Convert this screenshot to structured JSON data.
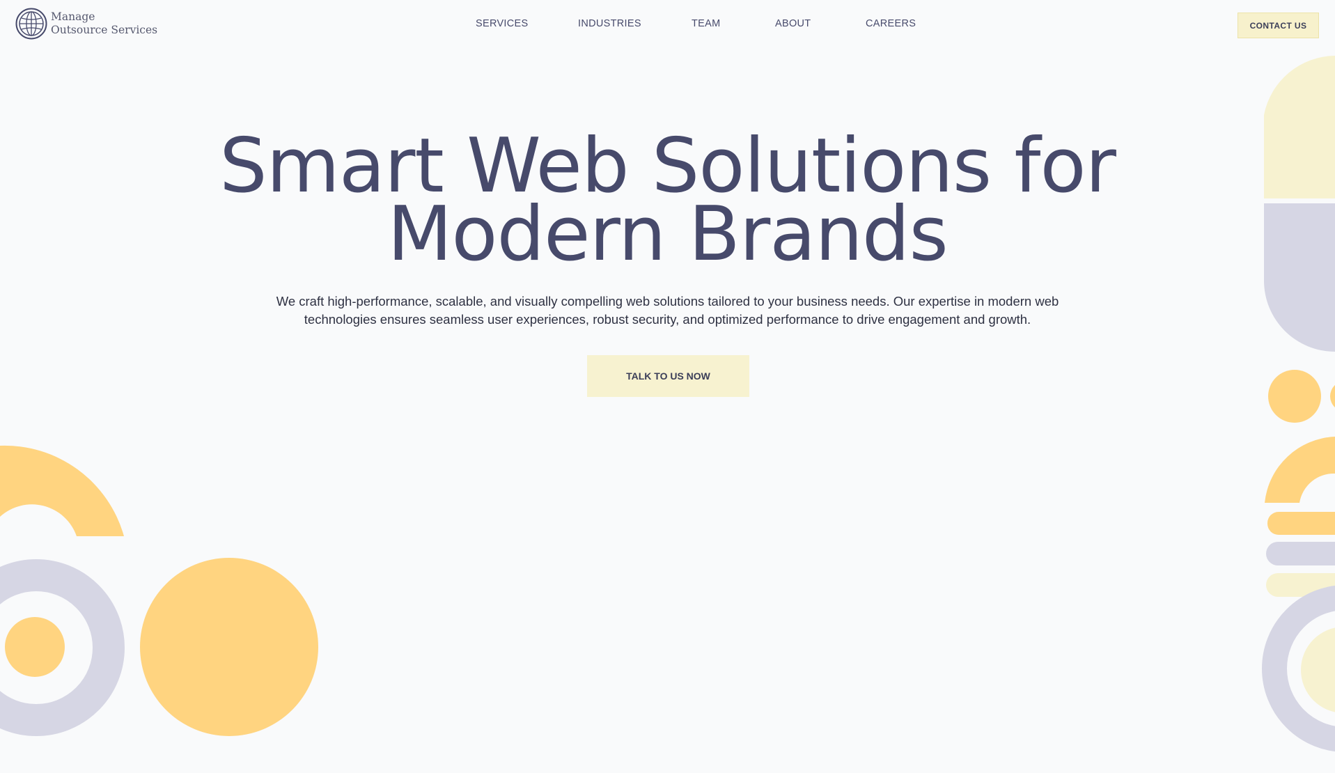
{
  "header": {
    "logo": {
      "line1": "Manage",
      "line2": "Outsource Services"
    },
    "nav": [
      {
        "label": "SERVICES"
      },
      {
        "label": "INDUSTRIES"
      },
      {
        "label": "TEAM"
      },
      {
        "label": "ABOUT"
      },
      {
        "label": "CAREERS"
      }
    ],
    "contact_label": "CONTACT US"
  },
  "hero": {
    "title_line1": "Smart Web Solutions for",
    "title_line2": "Modern Brands",
    "description": "We craft high-performance, scalable, and visually compelling web solutions tailored to your business needs. Our expertise in modern web technologies ensures seamless user experiences, robust security, and optimized performance to drive engagement and growth.",
    "cta_label": "TALK TO US NOW"
  },
  "colors": {
    "background": "#f9fafb",
    "text": "#474a6b",
    "accent_yellow": "#ffd480",
    "accent_cream": "#f7f2d0",
    "accent_lavender": "#d6d6e4"
  },
  "icons": {
    "logo": "globe-icon"
  }
}
